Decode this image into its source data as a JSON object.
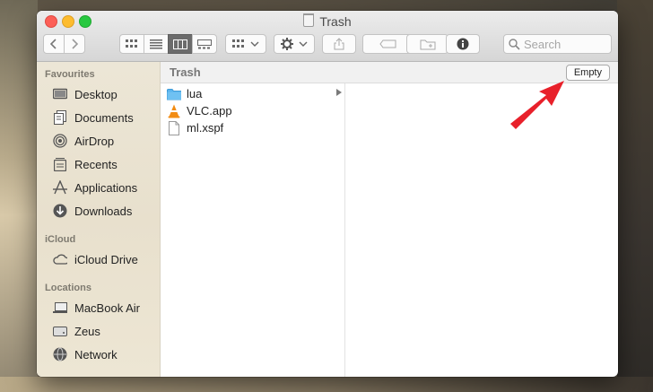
{
  "window": {
    "title": "Trash"
  },
  "toolbar": {
    "search_placeholder": "Search"
  },
  "sidebar": {
    "sections": [
      {
        "header": "Favourites",
        "items": [
          "Desktop",
          "Documents",
          "AirDrop",
          "Recents",
          "Applications",
          "Downloads"
        ]
      },
      {
        "header": "iCloud",
        "items": [
          "iCloud Drive"
        ]
      },
      {
        "header": "Locations",
        "items": [
          "MacBook Air",
          "Zeus",
          "Network"
        ]
      }
    ]
  },
  "pathbar": {
    "title": "Trash",
    "empty_label": "Empty"
  },
  "files": [
    {
      "name": "lua",
      "icon": "folder-icon",
      "has_children": true
    },
    {
      "name": "VLC.app",
      "icon": "vlc-icon",
      "has_children": false
    },
    {
      "name": "ml.xspf",
      "icon": "document-icon",
      "has_children": false
    }
  ],
  "colors": {
    "accent_arrow": "#e8202a",
    "folder": "#5ab4ee",
    "vlc": "#f28c13"
  }
}
